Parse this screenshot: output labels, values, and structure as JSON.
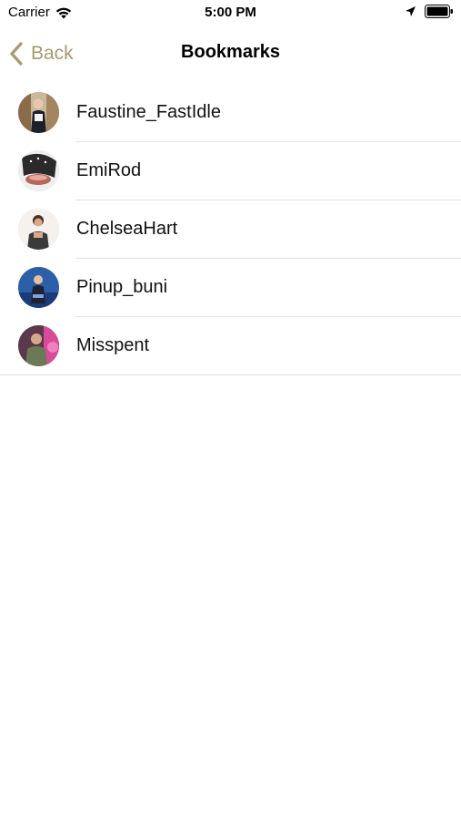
{
  "status_bar": {
    "carrier": "Carrier",
    "time": "5:00 PM",
    "icons": [
      "wifi-icon",
      "location-arrow-icon",
      "battery-icon"
    ]
  },
  "nav": {
    "back_label": "Back",
    "title": "Bookmarks",
    "accent_color": "#a89a6c"
  },
  "bookmarks": [
    {
      "name": "Faustine_FastIdle",
      "avatar": "avatar-photo"
    },
    {
      "name": "EmiRod",
      "avatar": "avatar-photo"
    },
    {
      "name": "ChelseaHart",
      "avatar": "avatar-photo"
    },
    {
      "name": "Pinup_buni",
      "avatar": "avatar-photo"
    },
    {
      "name": "Misspent",
      "avatar": "avatar-photo"
    }
  ]
}
